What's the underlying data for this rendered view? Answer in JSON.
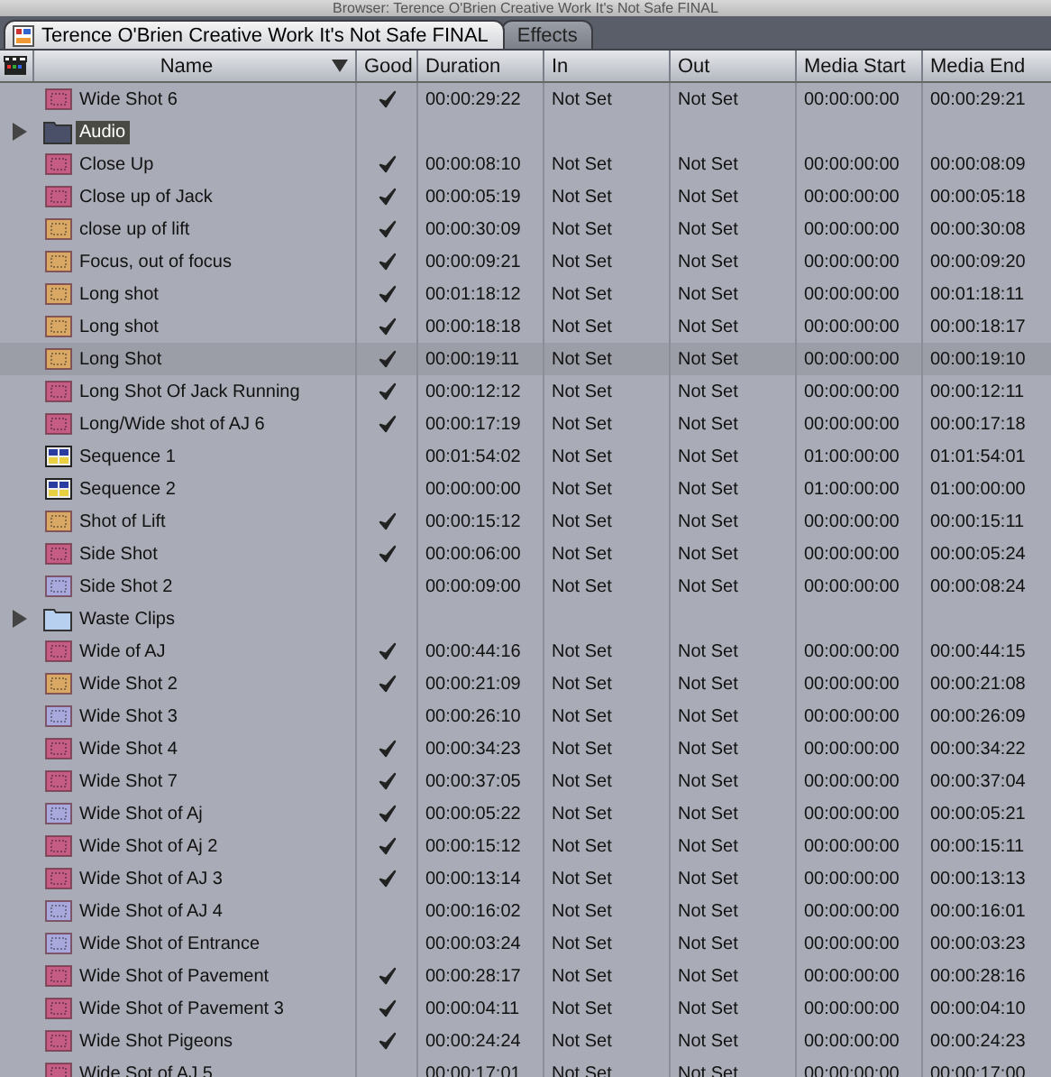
{
  "window": {
    "title": "Browser: Terence O'Brien Creative Work It's Not Safe FINAL"
  },
  "tabs": [
    {
      "label": "Terence O'Brien Creative Work It's Not Safe FINAL",
      "selected": true
    },
    {
      "label": "Effects",
      "selected": false
    }
  ],
  "table": {
    "columns": [
      "Name",
      "Good",
      "Duration",
      "In",
      "Out",
      "Media Start",
      "Media End"
    ],
    "rows": [
      {
        "kind": "clip",
        "color": "#c45c84",
        "name": "Wide Shot 6",
        "good": true,
        "selected": false,
        "editing": false,
        "duration": "00:00:29:22",
        "in": "Not Set",
        "out": "Not Set",
        "media_start": "00:00:00:00",
        "media_end": "00:00:29:21"
      },
      {
        "kind": "bin",
        "color": "#4a5068",
        "name": "Audio",
        "good": false,
        "selected": false,
        "editing": true,
        "expanded": false
      },
      {
        "kind": "clip",
        "color": "#c45c84",
        "name": "Close Up",
        "good": true,
        "selected": false,
        "editing": false,
        "duration": "00:00:08:10",
        "in": "Not Set",
        "out": "Not Set",
        "media_start": "00:00:00:00",
        "media_end": "00:00:08:09"
      },
      {
        "kind": "clip",
        "color": "#c45c84",
        "name": "Close up of Jack",
        "good": true,
        "selected": false,
        "editing": false,
        "duration": "00:00:05:19",
        "in": "Not Set",
        "out": "Not Set",
        "media_start": "00:00:00:00",
        "media_end": "00:00:05:18"
      },
      {
        "kind": "clip",
        "color": "#d8a864",
        "name": "close up of lift",
        "good": true,
        "selected": false,
        "editing": false,
        "duration": "00:00:30:09",
        "in": "Not Set",
        "out": "Not Set",
        "media_start": "00:00:00:00",
        "media_end": "00:00:30:08"
      },
      {
        "kind": "clip",
        "color": "#d8a864",
        "name": "Focus, out of focus",
        "good": true,
        "selected": false,
        "editing": false,
        "duration": "00:00:09:21",
        "in": "Not Set",
        "out": "Not Set",
        "media_start": "00:00:00:00",
        "media_end": "00:00:09:20"
      },
      {
        "kind": "clip",
        "color": "#d8a864",
        "name": "Long shot",
        "good": true,
        "selected": false,
        "editing": false,
        "duration": "00:01:18:12",
        "in": "Not Set",
        "out": "Not Set",
        "media_start": "00:00:00:00",
        "media_end": "00:01:18:11"
      },
      {
        "kind": "clip",
        "color": "#d8a864",
        "name": "Long shot",
        "good": true,
        "selected": false,
        "editing": false,
        "duration": "00:00:18:18",
        "in": "Not Set",
        "out": "Not Set",
        "media_start": "00:00:00:00",
        "media_end": "00:00:18:17"
      },
      {
        "kind": "clip",
        "color": "#d8a864",
        "name": "Long Shot",
        "good": true,
        "selected": true,
        "editing": false,
        "duration": "00:00:19:11",
        "in": "Not Set",
        "out": "Not Set",
        "media_start": "00:00:00:00",
        "media_end": "00:00:19:10"
      },
      {
        "kind": "clip",
        "color": "#c45c84",
        "name": "Long Shot Of Jack Running",
        "good": true,
        "selected": false,
        "editing": false,
        "duration": "00:00:12:12",
        "in": "Not Set",
        "out": "Not Set",
        "media_start": "00:00:00:00",
        "media_end": "00:00:12:11"
      },
      {
        "kind": "clip",
        "color": "#c45c84",
        "name": "Long/Wide shot of AJ 6",
        "good": true,
        "selected": false,
        "editing": false,
        "duration": "00:00:17:19",
        "in": "Not Set",
        "out": "Not Set",
        "media_start": "00:00:00:00",
        "media_end": "00:00:17:18"
      },
      {
        "kind": "sequence",
        "name": "Sequence 1",
        "good": false,
        "selected": false,
        "editing": false,
        "duration": "00:01:54:02",
        "in": "Not Set",
        "out": "Not Set",
        "media_start": "01:00:00:00",
        "media_end": "01:01:54:01"
      },
      {
        "kind": "sequence",
        "name": "Sequence 2",
        "good": false,
        "selected": false,
        "editing": false,
        "duration": "00:00:00:00",
        "in": "Not Set",
        "out": "Not Set",
        "media_start": "01:00:00:00",
        "media_end": "01:00:00:00"
      },
      {
        "kind": "clip",
        "color": "#d8a864",
        "name": "Shot of Lift",
        "good": true,
        "selected": false,
        "editing": false,
        "duration": "00:00:15:12",
        "in": "Not Set",
        "out": "Not Set",
        "media_start": "00:00:00:00",
        "media_end": "00:00:15:11"
      },
      {
        "kind": "clip",
        "color": "#c45c84",
        "name": "Side Shot",
        "good": true,
        "selected": false,
        "editing": false,
        "duration": "00:00:06:00",
        "in": "Not Set",
        "out": "Not Set",
        "media_start": "00:00:00:00",
        "media_end": "00:00:05:24"
      },
      {
        "kind": "clip",
        "color": "#a8a8dc",
        "name": "Side Shot 2",
        "good": false,
        "selected": false,
        "editing": false,
        "duration": "00:00:09:00",
        "in": "Not Set",
        "out": "Not Set",
        "media_start": "00:00:00:00",
        "media_end": "00:00:08:24"
      },
      {
        "kind": "bin",
        "color": "#b8d0f0",
        "name": "Waste Clips",
        "good": false,
        "selected": false,
        "editing": false,
        "expanded": false
      },
      {
        "kind": "clip",
        "color": "#c45c84",
        "name": "Wide of AJ",
        "good": true,
        "selected": false,
        "editing": false,
        "duration": "00:00:44:16",
        "in": "Not Set",
        "out": "Not Set",
        "media_start": "00:00:00:00",
        "media_end": "00:00:44:15"
      },
      {
        "kind": "clip",
        "color": "#d8a864",
        "name": "Wide Shot 2",
        "good": true,
        "selected": false,
        "editing": false,
        "duration": "00:00:21:09",
        "in": "Not Set",
        "out": "Not Set",
        "media_start": "00:00:00:00",
        "media_end": "00:00:21:08"
      },
      {
        "kind": "clip",
        "color": "#a8a8dc",
        "name": "Wide Shot 3",
        "good": false,
        "selected": false,
        "editing": false,
        "duration": "00:00:26:10",
        "in": "Not Set",
        "out": "Not Set",
        "media_start": "00:00:00:00",
        "media_end": "00:00:26:09"
      },
      {
        "kind": "clip",
        "color": "#c45c84",
        "name": "Wide Shot 4",
        "good": true,
        "selected": false,
        "editing": false,
        "duration": "00:00:34:23",
        "in": "Not Set",
        "out": "Not Set",
        "media_start": "00:00:00:00",
        "media_end": "00:00:34:22"
      },
      {
        "kind": "clip",
        "color": "#c45c84",
        "name": "Wide Shot 7",
        "good": true,
        "selected": false,
        "editing": false,
        "duration": "00:00:37:05",
        "in": "Not Set",
        "out": "Not Set",
        "media_start": "00:00:00:00",
        "media_end": "00:00:37:04"
      },
      {
        "kind": "clip",
        "color": "#a8a8dc",
        "name": "Wide Shot of Aj",
        "good": true,
        "selected": false,
        "editing": false,
        "duration": "00:00:05:22",
        "in": "Not Set",
        "out": "Not Set",
        "media_start": "00:00:00:00",
        "media_end": "00:00:05:21"
      },
      {
        "kind": "clip",
        "color": "#c45c84",
        "name": "Wide Shot of Aj 2",
        "good": true,
        "selected": false,
        "editing": false,
        "duration": "00:00:15:12",
        "in": "Not Set",
        "out": "Not Set",
        "media_start": "00:00:00:00",
        "media_end": "00:00:15:11"
      },
      {
        "kind": "clip",
        "color": "#c45c84",
        "name": "Wide Shot of AJ 3",
        "good": true,
        "selected": false,
        "editing": false,
        "duration": "00:00:13:14",
        "in": "Not Set",
        "out": "Not Set",
        "media_start": "00:00:00:00",
        "media_end": "00:00:13:13"
      },
      {
        "kind": "clip",
        "color": "#a8a8dc",
        "name": "Wide Shot of AJ 4",
        "good": false,
        "selected": false,
        "editing": false,
        "duration": "00:00:16:02",
        "in": "Not Set",
        "out": "Not Set",
        "media_start": "00:00:00:00",
        "media_end": "00:00:16:01"
      },
      {
        "kind": "clip",
        "color": "#a8a8dc",
        "name": "Wide Shot of Entrance",
        "good": false,
        "selected": false,
        "editing": false,
        "duration": "00:00:03:24",
        "in": "Not Set",
        "out": "Not Set",
        "media_start": "00:00:00:00",
        "media_end": "00:00:03:23"
      },
      {
        "kind": "clip",
        "color": "#c45c84",
        "name": "Wide Shot of Pavement",
        "good": true,
        "selected": false,
        "editing": false,
        "duration": "00:00:28:17",
        "in": "Not Set",
        "out": "Not Set",
        "media_start": "00:00:00:00",
        "media_end": "00:00:28:16"
      },
      {
        "kind": "clip",
        "color": "#c45c84",
        "name": "Wide Shot of Pavement 3",
        "good": true,
        "selected": false,
        "editing": false,
        "duration": "00:00:04:11",
        "in": "Not Set",
        "out": "Not Set",
        "media_start": "00:00:00:00",
        "media_end": "00:00:04:10"
      },
      {
        "kind": "clip",
        "color": "#c45c84",
        "name": "Wide Shot Pigeons",
        "good": true,
        "selected": false,
        "editing": false,
        "duration": "00:00:24:24",
        "in": "Not Set",
        "out": "Not Set",
        "media_start": "00:00:00:00",
        "media_end": "00:00:24:23"
      },
      {
        "kind": "clip",
        "color": "#c45c84",
        "name": "Wide Sot of AJ 5",
        "good": false,
        "selected": false,
        "editing": false,
        "duration": "00:00:17:01",
        "in": "Not Set",
        "out": "Not Set",
        "media_start": "00:00:00:00",
        "media_end": "00:00:17:00"
      }
    ]
  }
}
